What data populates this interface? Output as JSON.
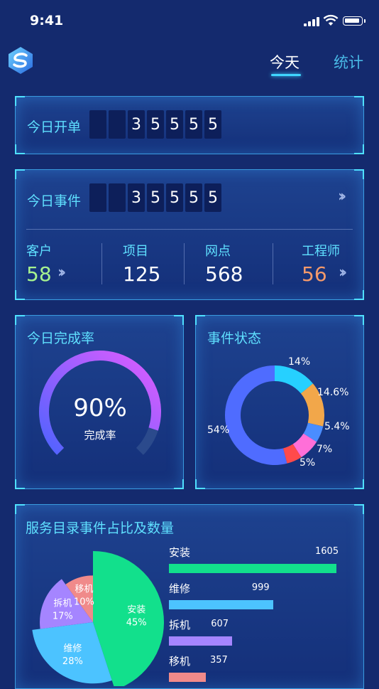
{
  "status_bar": {
    "time": "9:41"
  },
  "header": {
    "tabs": [
      {
        "label": "今天",
        "active": true
      },
      {
        "label": "统计",
        "active": false
      }
    ]
  },
  "orders_today": {
    "title": "今日开单",
    "digits": [
      "",
      "",
      "3",
      "5",
      "5",
      "5",
      "5"
    ]
  },
  "events_today": {
    "title": "今日事件",
    "digits": [
      "",
      "",
      "3",
      "5",
      "5",
      "5",
      "5"
    ],
    "stats": [
      {
        "label": "客户",
        "value": "58",
        "color": "#a6f28f"
      },
      {
        "label": "项目",
        "value": "125",
        "color": "#ffffff"
      },
      {
        "label": "网点",
        "value": "568",
        "color": "#ffffff"
      },
      {
        "label": "工程师",
        "value": "56",
        "color": "#f59a6b"
      }
    ]
  },
  "completion": {
    "title": "今日完成率",
    "percent_text": "90%",
    "caption": "完成率",
    "value": 0.9
  },
  "event_status": {
    "title": "事件状态",
    "segments": [
      {
        "label": "14%",
        "value": 14,
        "color": "#26d0ff"
      },
      {
        "label": "14.6%",
        "value": 14.6,
        "color": "#f2a74a"
      },
      {
        "label": "5.4%",
        "value": 5.4,
        "color": "#4a8dff"
      },
      {
        "label": "7%",
        "value": 7,
        "color": "#ff6fd8"
      },
      {
        "label": "5%",
        "value": 5,
        "color": "#ff4a4a"
      },
      {
        "label": "54%",
        "value": 54,
        "color": "#4f6cff"
      }
    ]
  },
  "service_catalog": {
    "title": "服务目录事件占比及数量",
    "items": [
      {
        "name": "安装",
        "count": "1605",
        "value": 1605,
        "percent": "45%",
        "color": "#12e08c"
      },
      {
        "name": "维修",
        "count": "999",
        "value": 999,
        "percent": "28%",
        "color": "#4cc3ff"
      },
      {
        "name": "拆机",
        "count": "607",
        "value": 607,
        "percent": "17%",
        "color": "#a585ff"
      },
      {
        "name": "移机",
        "count": "357",
        "value": 357,
        "percent": "10%",
        "color": "#f08a8a"
      }
    ]
  }
}
